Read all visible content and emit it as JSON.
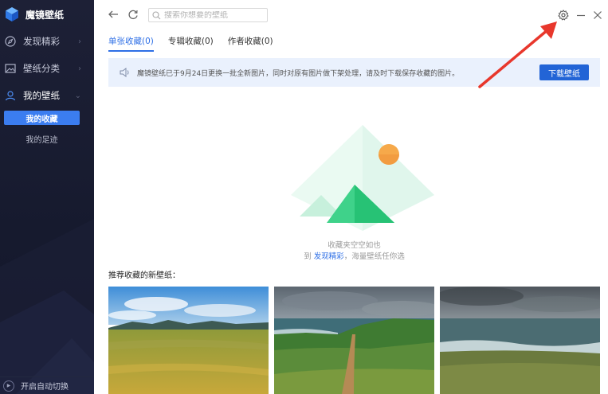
{
  "app": {
    "title": "魔镜壁纸"
  },
  "sidebar": {
    "items": [
      {
        "label": "发现精彩",
        "icon": "compass-icon"
      },
      {
        "label": "壁纸分类",
        "icon": "image-icon"
      },
      {
        "label": "我的壁纸",
        "icon": "user-icon"
      }
    ],
    "sub_items": [
      {
        "label": "我的收藏",
        "active": true
      },
      {
        "label": "我的足迹",
        "active": false
      }
    ],
    "auto_switch": "开启自动切换"
  },
  "topbar": {
    "search_placeholder": "搜索你想要的壁纸"
  },
  "tabs": [
    {
      "label": "单张收藏(0)",
      "active": true
    },
    {
      "label": "专辑收藏(0)",
      "active": false
    },
    {
      "label": "作者收藏(0)",
      "active": false
    }
  ],
  "notice": {
    "text": "魔镜壁纸已于9月24日更换一批全新图片，同时对原有图片做下架处理，请及时下载保存收藏的图片。",
    "button": "下载壁纸"
  },
  "empty": {
    "line1": "收藏夹空空如也",
    "line2_prefix": "到",
    "line2_link": "发现精彩",
    "line2_suffix": "，海量壁纸任你选"
  },
  "recommend": {
    "title": "推荐收藏的新壁纸："
  },
  "colors": {
    "accent": "#2e6fe6",
    "sidebar_bg": "#1d2036",
    "notice_bg": "#eaf1fd",
    "annotation": "#e8372c"
  }
}
